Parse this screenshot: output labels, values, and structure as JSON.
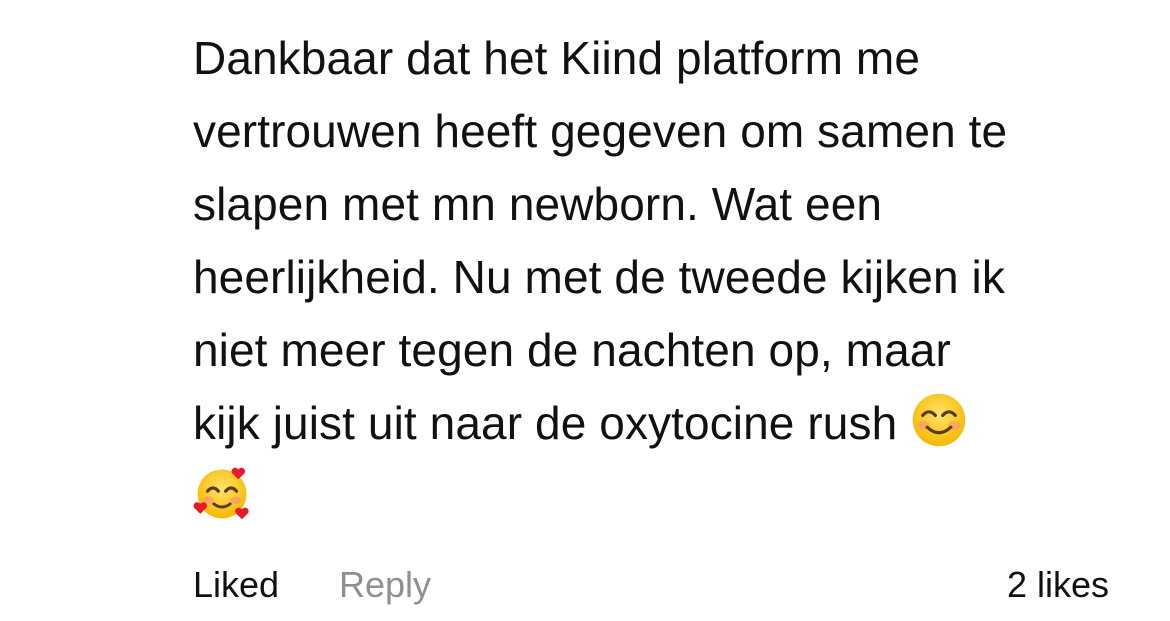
{
  "comment": {
    "lines": [
      "Dankbaar dat het Kiind platform me",
      "vertrouwen heeft gegeven om samen te",
      "slapen met mn newborn. Wat een",
      "heerlijkheid. Nu met de tweede kijken ik",
      "niet meer tegen de nachten op, maar",
      "kijk juist uit naar de oxytocine rush"
    ],
    "emojis": [
      "smiling-face-with-smiling-eyes",
      "smiling-face-with-hearts"
    ]
  },
  "actions": {
    "liked_label": "Liked",
    "reply_label": "Reply",
    "likes_count": "2 likes"
  },
  "colors": {
    "text": "#111111",
    "secondary": "#8e8e93",
    "background": "#ffffff"
  }
}
